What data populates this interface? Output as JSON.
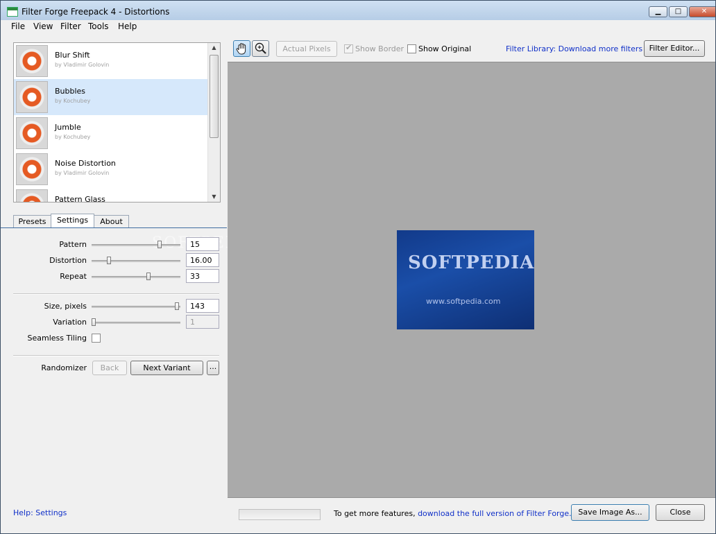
{
  "window": {
    "title": "Filter Forge Freepack 4 - Distortions",
    "minimize": "▁",
    "maximize": "□",
    "close": "✕"
  },
  "menu": [
    "File",
    "View",
    "Filter",
    "Tools",
    "Help"
  ],
  "filters": [
    {
      "name": "Blur Shift",
      "author": "by Vladimir Golovin"
    },
    {
      "name": "Bubbles",
      "author": "by Kochubey"
    },
    {
      "name": "Jumble",
      "author": "by Kochubey"
    },
    {
      "name": "Noise Distortion",
      "author": "by Vladimir Golovin"
    },
    {
      "name": "Pattern Glass",
      "author": ""
    }
  ],
  "selected_filter": "Bubbles",
  "tabs": [
    "Presets",
    "Settings",
    "About"
  ],
  "active_tab": "Settings",
  "settings": {
    "pattern": {
      "label": "Pattern",
      "value": "15",
      "level": 0.78
    },
    "distortion": {
      "label": "Distortion",
      "value": "16.00",
      "level": 0.18
    },
    "repeat": {
      "label": "Repeat",
      "value": "33",
      "level": 0.65
    },
    "size": {
      "label": "Size, pixels",
      "value": "143",
      "level": 0.98
    },
    "variation": {
      "label": "Variation",
      "value": "1",
      "level": 0.0
    },
    "seamless": {
      "label": "Seamless Tiling",
      "checked": false
    }
  },
  "randomizer": {
    "label": "Randomizer",
    "back": "Back",
    "next": "Next Variant",
    "more": "..."
  },
  "help_link": "Help: Settings",
  "toolbar": {
    "actual_pixels": "Actual Pixels",
    "show_border": "Show Border",
    "show_original": "Show Original",
    "library_link": "Filter Library: Download more filters",
    "filter_editor": "Filter Editor..."
  },
  "preview": {
    "text": "SOFTPEDIA",
    "subtext": "www.softpedia.com"
  },
  "watermark": "SOFTPEDIA",
  "footer": {
    "prefix": "To get more features, ",
    "link": "download the full version of Filter Forge.",
    "save": "Save Image As...",
    "close": "Close"
  }
}
